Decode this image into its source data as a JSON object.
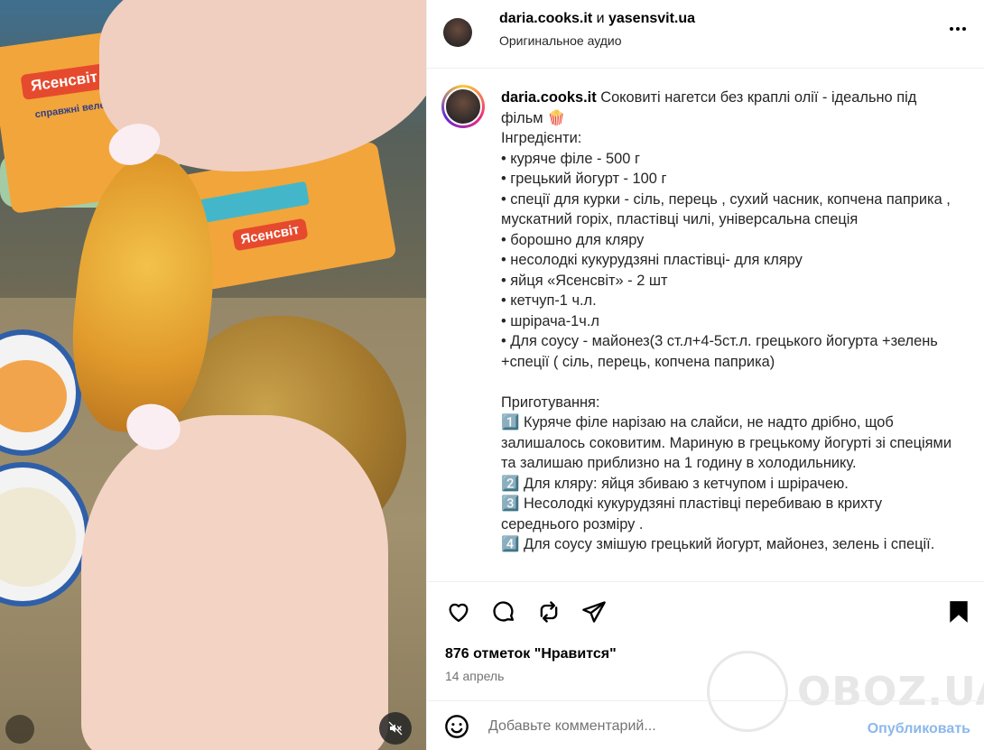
{
  "media": {
    "box_label": "Ясенсвіт",
    "box_sub": "справжні велетні"
  },
  "header": {
    "user1": "daria.cooks.it",
    "and": " и ",
    "user2": "yasensvit.ua",
    "audio": "Оригинальное аудио"
  },
  "caption": {
    "username": "daria.cooks.it",
    "text": " Соковиті нагетси без краплі олії - ідеально під фільм 🍿\nІнгредієнти:\n• куряче філе - 500 г\n• грецький йогурт - 100 г\n• спеції для курки - сіль, перець , сухий часник, копчена паприка , мускатний горіх, пластівці чилі, універсальна спеція\n• борошно для кляру\n• несолодкі кукурудзяні пластівці- для кляру\n• яйця «Ясенсвіт» - 2 шт\n• кетчуп-1 ч.л.\n• шрірача-1ч.л\n• Для соусу - майонез(3 ст.л+4-5ст.л. грецького йогурта +зелень +спеції ( сіль, перець, копчена паприка)\n\nПриготування:\n1️⃣ Куряче філе нарізаю на слайси, не надто дрібно, щоб залишалось соковитим. Мариную в грецькому йогурті зі спеціями та залишаю приблизно на 1 годину в холодильнику.\n2️⃣ Для кляру: яйця збиваю з кетчупом і шрірачею.\n3️⃣ Несолодкі кукурудзяні пластівці перебиваю в крихту середнього розміру .\n4️⃣ Для соусу змішую грецький йогурт, майонез, зелень і спеції."
  },
  "actions": {
    "likes": "876 отметок \"Нравится\"",
    "date": "14 апрель"
  },
  "watermark": "OBOZ.UA",
  "comment": {
    "placeholder": "Добавьте комментарий...",
    "post_label": "Опубликовать"
  },
  "colors": {
    "post_disabled": "#8ab8ec",
    "muted_text": "#737373"
  },
  "icons": [
    "more-icon",
    "heart-icon",
    "comment-icon",
    "repost-icon",
    "share-icon",
    "bookmark-icon",
    "emoji-icon",
    "mute-icon"
  ]
}
